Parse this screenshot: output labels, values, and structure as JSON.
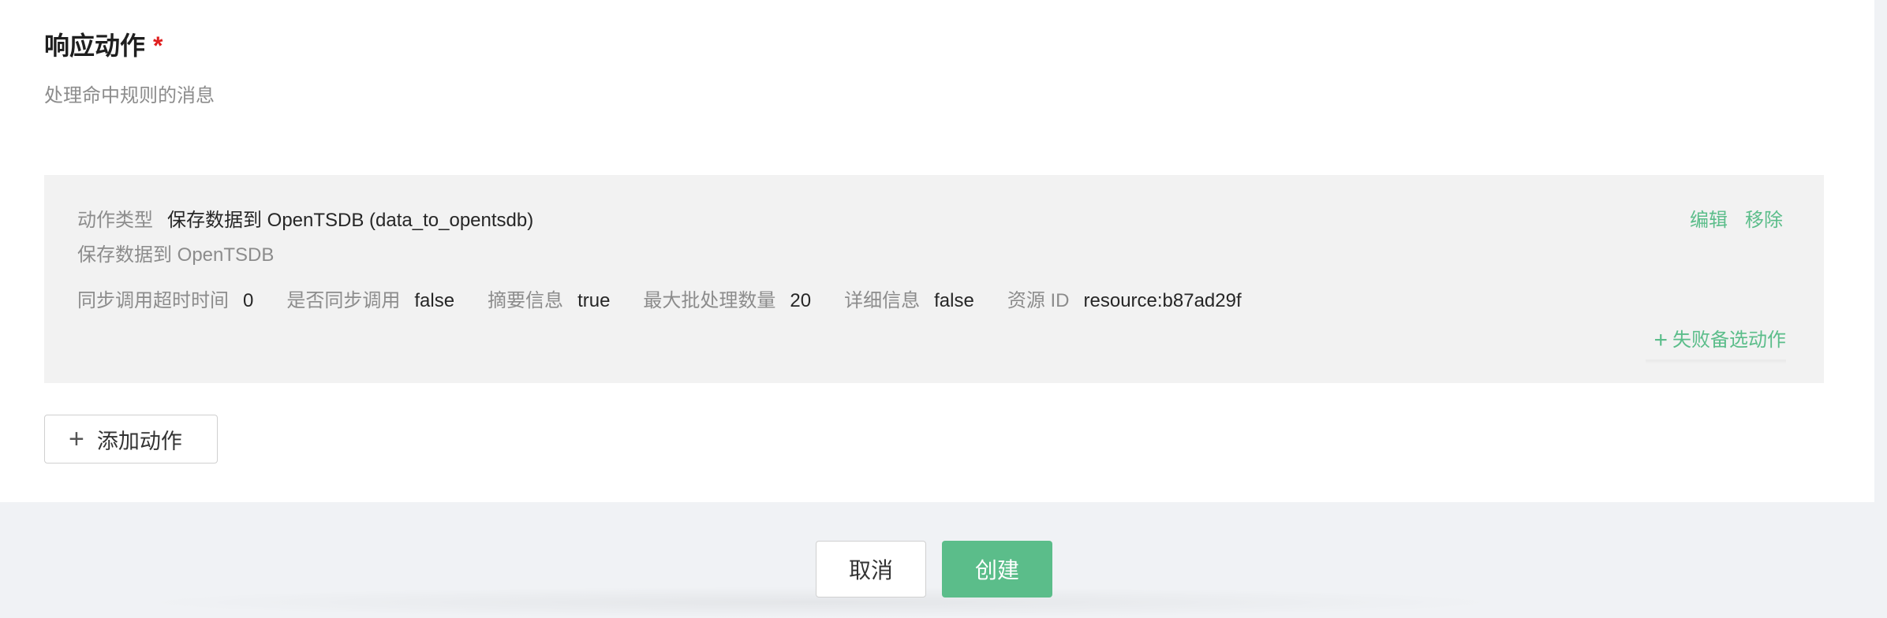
{
  "section": {
    "title": "响应动作",
    "required_mark": "*",
    "description": "处理命中规则的消息"
  },
  "action": {
    "type_label": "动作类型",
    "type_value": "保存数据到 OpenTSDB (data_to_opentsdb)",
    "description": "保存数据到 OpenTSDB",
    "edit_label": "编辑",
    "remove_label": "移除",
    "params": [
      {
        "label": "同步调用超时时间",
        "value": "0"
      },
      {
        "label": "是否同步调用",
        "value": "false"
      },
      {
        "label": "摘要信息",
        "value": "true"
      },
      {
        "label": "最大批处理数量",
        "value": "20"
      },
      {
        "label": "详细信息",
        "value": "false"
      },
      {
        "label": "资源 ID",
        "value": "resource:b87ad29f"
      }
    ],
    "fallback_label": "失败备选动作",
    "fallback_icon": "+"
  },
  "add_action": {
    "icon": "+",
    "label": "添加动作"
  },
  "footer": {
    "cancel_label": "取消",
    "create_label": "创建"
  },
  "colors": {
    "accent": "#5bbd8a",
    "required": "#e02020",
    "panel_bg": "#f2f2f2",
    "page_bg": "#f0f2f5"
  }
}
